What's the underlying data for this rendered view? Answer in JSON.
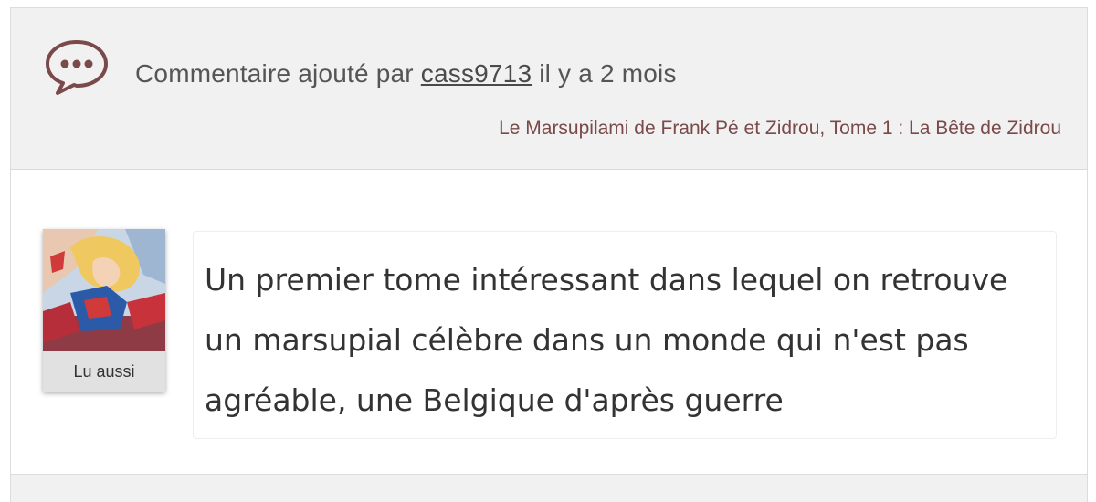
{
  "header": {
    "prefix": "Commentaire ajouté par",
    "username": "cass9713",
    "time_ago": "il y a 2 mois",
    "book_title": "Le Marsupilami de Frank Pé et Zidrou, Tome 1 : La Bête de Zidrou",
    "icon": "speech-bubble-icon",
    "icon_color": "#7a4a4a"
  },
  "avatar": {
    "label": "Lu aussi"
  },
  "comment": {
    "text": "Un premier tome intéressant dans lequel on retrouve un marsupial célèbre dans un monde qui n'est pas agréable, une Belgique d'après guerre"
  }
}
